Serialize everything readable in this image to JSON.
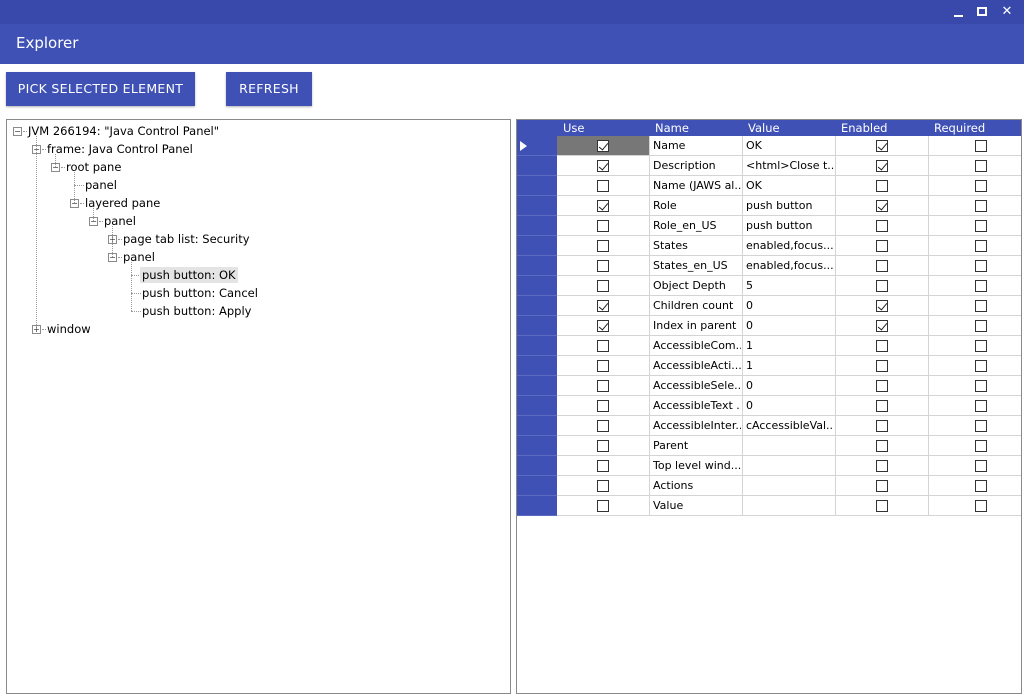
{
  "window": {
    "title": "Explorer",
    "controls": {
      "minimize_icon": "minimize-icon",
      "maximize_icon": "maximize-icon",
      "close_glyph": "✕"
    }
  },
  "toolbar": {
    "pick_label": "PICK SELECTED ELEMENT",
    "refresh_label": "REFRESH"
  },
  "colors": {
    "accent": "#3f51b5",
    "titlebar": "#3949ab"
  },
  "tree": {
    "nodes": [
      {
        "label": "JVM 266194: \"Java Control Panel\"",
        "level": 0,
        "expander": "−",
        "selected": false
      },
      {
        "label": "frame: Java Control Panel",
        "level": 1,
        "expander": "−",
        "selected": false
      },
      {
        "label": "root pane",
        "level": 2,
        "expander": "−",
        "selected": false
      },
      {
        "label": "panel",
        "level": 3,
        "expander": "",
        "selected": false
      },
      {
        "label": "layered pane",
        "level": 3,
        "expander": "−",
        "selected": false
      },
      {
        "label": "panel",
        "level": 4,
        "expander": "−",
        "selected": false
      },
      {
        "label": "page tab list: Security",
        "level": 5,
        "expander": "+",
        "selected": false
      },
      {
        "label": "panel",
        "level": 5,
        "expander": "−",
        "selected": false
      },
      {
        "label": "push button: OK",
        "level": 6,
        "expander": "",
        "selected": true
      },
      {
        "label": "push button: Cancel",
        "level": 6,
        "expander": "",
        "selected": false
      },
      {
        "label": "push button: Apply",
        "level": 6,
        "expander": "",
        "selected": false
      },
      {
        "label": "window",
        "level": 1,
        "expander": "+",
        "selected": false
      }
    ]
  },
  "grid": {
    "headers": {
      "use": "Use",
      "name": "Name",
      "value": "Value",
      "enabled": "Enabled",
      "required": "Required"
    },
    "rows": [
      {
        "use": true,
        "name": "Name",
        "value": "OK",
        "enabled": true,
        "required": false,
        "current": true
      },
      {
        "use": true,
        "name": "Description",
        "value": "<html>Close t...",
        "enabled": true,
        "required": false
      },
      {
        "use": false,
        "name": "Name (JAWS al...",
        "value": "OK",
        "enabled": false,
        "required": false
      },
      {
        "use": true,
        "name": "Role",
        "value": "push button",
        "enabled": true,
        "required": false
      },
      {
        "use": false,
        "name": "Role_en_US",
        "value": "push button",
        "enabled": false,
        "required": false
      },
      {
        "use": false,
        "name": "States",
        "value": "enabled,focus...",
        "enabled": false,
        "required": false
      },
      {
        "use": false,
        "name": "States_en_US",
        "value": "enabled,focus...",
        "enabled": false,
        "required": false
      },
      {
        "use": false,
        "name": "Object Depth",
        "value": "5",
        "enabled": false,
        "required": false
      },
      {
        "use": true,
        "name": "Children count",
        "value": "0",
        "enabled": true,
        "required": false
      },
      {
        "use": true,
        "name": "Index in parent",
        "value": "0",
        "enabled": true,
        "required": false
      },
      {
        "use": false,
        "name": "AccessibleCom...",
        "value": "1",
        "enabled": false,
        "required": false
      },
      {
        "use": false,
        "name": "AccessibleActi...",
        "value": "1",
        "enabled": false,
        "required": false
      },
      {
        "use": false,
        "name": "AccessibleSele...",
        "value": "0",
        "enabled": false,
        "required": false
      },
      {
        "use": false,
        "name": "AccessibleText ...",
        "value": "0",
        "enabled": false,
        "required": false
      },
      {
        "use": false,
        "name": "AccessibleInter...",
        "value": "cAccessibleVal...",
        "enabled": false,
        "required": false
      },
      {
        "use": false,
        "name": "Parent",
        "value": "",
        "enabled": false,
        "required": false
      },
      {
        "use": false,
        "name": "Top level wind...",
        "value": "",
        "enabled": false,
        "required": false
      },
      {
        "use": false,
        "name": "Actions",
        "value": "",
        "enabled": false,
        "required": false
      },
      {
        "use": false,
        "name": "Value",
        "value": "",
        "enabled": false,
        "required": false
      }
    ]
  }
}
